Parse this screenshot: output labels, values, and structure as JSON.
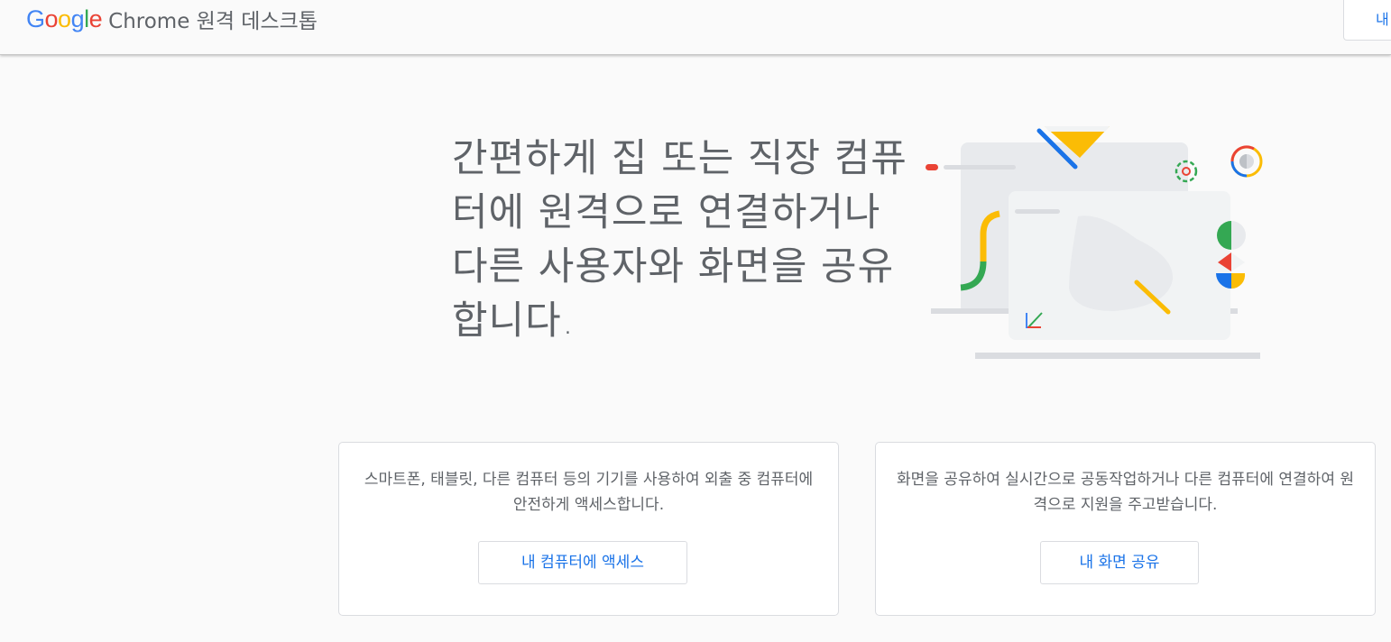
{
  "header": {
    "logo_letters": [
      {
        "ch": "G",
        "color": "#4285f4"
      },
      {
        "ch": "o",
        "color": "#ea4335"
      },
      {
        "ch": "o",
        "color": "#fbbc05"
      },
      {
        "ch": "g",
        "color": "#4285f4"
      },
      {
        "ch": "l",
        "color": "#34a853"
      },
      {
        "ch": "e",
        "color": "#ea4335"
      }
    ],
    "product_name": "Chrome 원격 데스크톱",
    "right_button_label": "내"
  },
  "hero": {
    "title": "간편하게 집 또는 직장 컴퓨터에 원격으로 연결하거나 다른 사용자와 화면을 공유합니다."
  },
  "cards": [
    {
      "description": "스마트폰, 태블릿, 다른 컴퓨터 등의 기기를 사용하여 외출 중 컴퓨터에 안전하게 액세스합니다.",
      "button_label": "내 컴퓨터에 액세스"
    },
    {
      "description": "화면을 공유하여 실시간으로 공동작업하거나 다른 컴퓨터에 연결하여 원격으로 지원을 주고받습니다.",
      "button_label": "내 화면 공유"
    }
  ],
  "colors": {
    "blue": "#4285f4",
    "red": "#ea4335",
    "yellow": "#fbbc05",
    "green": "#34a853",
    "link_blue": "#1a73e8"
  }
}
